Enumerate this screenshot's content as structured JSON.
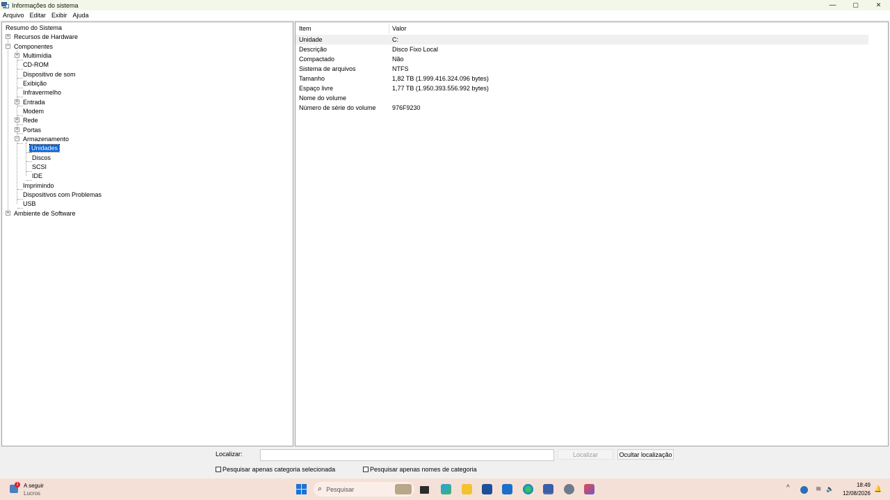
{
  "window": {
    "title": "Informações do sistema",
    "controls": {
      "minimize": "—",
      "maximize": "▢",
      "close": "✕"
    }
  },
  "menu": [
    "Arquivo",
    "Editar",
    "Exibir",
    "Ajuda"
  ],
  "tree": {
    "root": "Resumo do Sistema",
    "hardware": "Recursos de Hardware",
    "components": "Componentes",
    "multimedia": "Multimídia",
    "cdrom": "CD-ROM",
    "sound": "Dispositivo de som",
    "display": "Exibição",
    "infrared": "Infravermelho",
    "input": "Entrada",
    "modem": "Modem",
    "network": "Rede",
    "ports": "Portas",
    "storage": "Armazenamento",
    "drives": "Unidades",
    "disks": "Discos",
    "scsi": "SCSI",
    "ide": "IDE",
    "printing": "Imprimindo",
    "problem_devices": "Dispositivos com Problemas",
    "usb": "USB",
    "software": "Ambiente de Software",
    "expand_glyph": "+",
    "collapse_glyph": "−"
  },
  "table": {
    "headers": {
      "item": "Item",
      "value": "Valor"
    },
    "rows": [
      {
        "item": "Unidade",
        "value": "C:"
      },
      {
        "item": "Descrição",
        "value": "Disco Fixo Local"
      },
      {
        "item": "Compactado",
        "value": "Não"
      },
      {
        "item": "Sistema de arquivos",
        "value": "NTFS"
      },
      {
        "item": "Tamanho",
        "value": "1,82 TB (1.999.416.324.096 bytes)"
      },
      {
        "item": "Espaço livre",
        "value": "1,77 TB (1.950.393.556.992 bytes)"
      },
      {
        "item": "Nome do volume",
        "value": ""
      },
      {
        "item": "Número de série do volume",
        "value": "976F9230"
      }
    ]
  },
  "find": {
    "label": "Localizar:",
    "value": "",
    "find_button": "Localizar",
    "hide_button": "Ocultar localização",
    "option_selected_category": "Pesquisar apenas categoria selecionada",
    "option_category_names": "Pesquisar apenas nomes de categoria"
  },
  "taskbar": {
    "weather_badge": "1",
    "weather_title": "A seguir",
    "weather_sub": "Lucros",
    "search_placeholder": "Pesquisar",
    "search_glyph": "⌕",
    "time": "18:49",
    "date": "12/08/2026",
    "tray": {
      "chevron": "^",
      "wifi": "≋",
      "volume": "🔈",
      "notif": "🔔"
    },
    "accent": "#1a73d4"
  }
}
